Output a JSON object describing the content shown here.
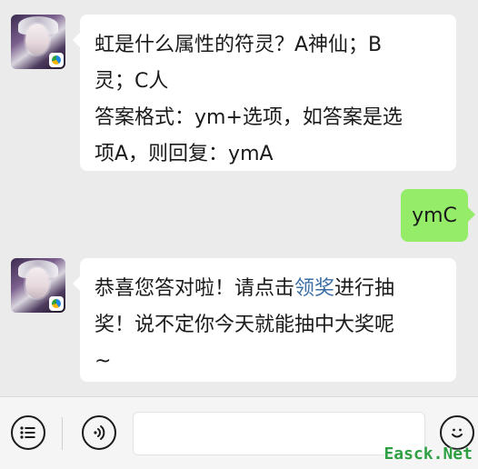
{
  "messages": [
    {
      "side": "left",
      "lines": [
        "虹是什么属性的符灵？A神仙；B",
        "灵；C人",
        "答案格式：ym+选项，如答案是选",
        "项A，则回复：ymA"
      ]
    },
    {
      "side": "right",
      "text": "ymC"
    },
    {
      "side": "left",
      "line1_pre": "恭喜您答对啦！请点击",
      "line1_link": "领奖",
      "line1_post": "进行抽",
      "line2": "奖！说不定你今天就能抽中大奖呢",
      "line3": "~"
    }
  ],
  "toolbar": {
    "menu_icon": "list-menu-icon",
    "voice_icon": "voice-icon",
    "emoji_icon": "emoji-icon"
  },
  "watermark": "Easck.Net",
  "colors": {
    "background": "#ebebeb",
    "bubble_left": "#ffffff",
    "bubble_right": "#95ec69",
    "link": "#3a6ea5",
    "watermark": "#2ea043"
  }
}
